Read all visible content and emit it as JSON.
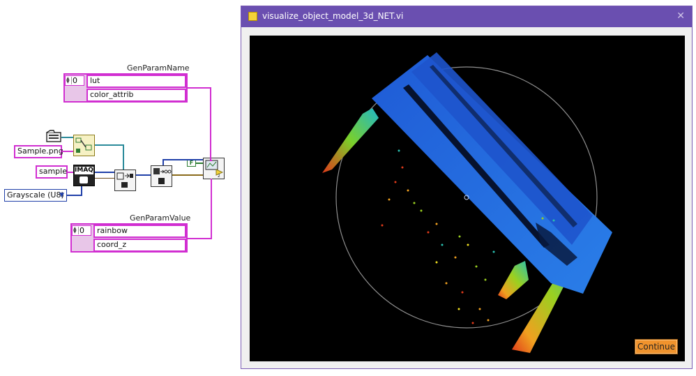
{
  "block_diagram": {
    "genparamname_label": "GenParamName",
    "genparamname_index": "0",
    "genparamname_items": [
      "lut",
      "color_attrib"
    ],
    "genparamvalue_label": "GenParamValue",
    "genparamvalue_index": "0",
    "genparamvalue_items": [
      "rainbow",
      "coord_z"
    ],
    "file_constant": "Sample.png",
    "image_name_constant": "sample",
    "image_type_enum": "Grayscale (U8)",
    "imaq_label": "IMAQ",
    "bool_constant": "F"
  },
  "window": {
    "title": "visualize_object_model_3d_NET.vi",
    "close_glyph": "✕",
    "continue_label": "Continue"
  },
  "icons": {
    "title_icon": "labview-vi-icon",
    "close_icon": "close-icon"
  },
  "colors": {
    "titlebar": "#6a4fb0",
    "wire_string": "#d12ed1",
    "continue_button": "#f0932d",
    "canvas": "#000000"
  }
}
